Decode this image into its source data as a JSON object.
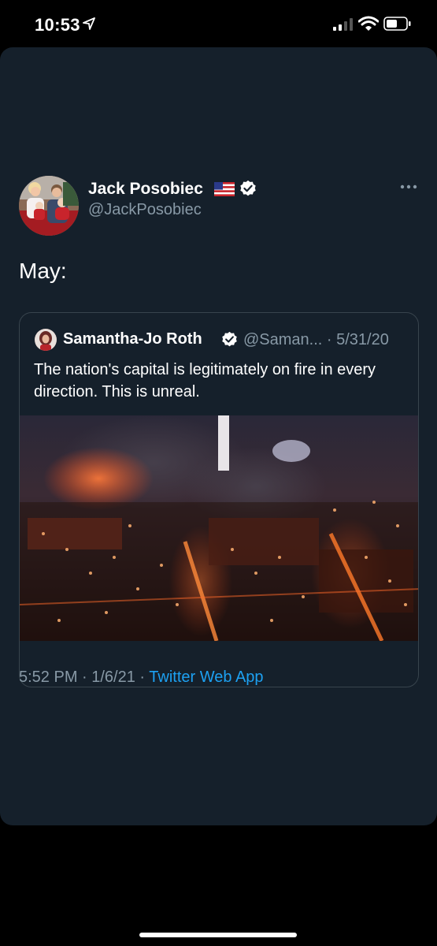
{
  "status_bar": {
    "time": "10:53",
    "icons": [
      "location-arrow-icon",
      "cellular-signal-icon",
      "wifi-icon",
      "battery-icon"
    ]
  },
  "tweet": {
    "author_name": "Jack Posobiec",
    "author_handle": "@JackPosobiec",
    "badges": [
      "us-flag-icon",
      "verified-icon"
    ],
    "text": "May:",
    "timestamp": "5:52 PM · 1/6/21 · ",
    "source": "Twitter Web App",
    "quote": {
      "author_name": "Samantha-Jo Roth",
      "author_handle": "@Saman... · 5/31/20",
      "text": "The nation's capital is legitimately on fire in every direction. This is unreal.",
      "media": "night-aerial-city-fire-photo"
    }
  },
  "colors": {
    "background": "#000000",
    "card": "#15202b",
    "text_primary": "#ffffff",
    "text_secondary": "#8899a6",
    "link": "#1da1f2",
    "border": "#38444d",
    "verified_badge": "#ffffff"
  }
}
